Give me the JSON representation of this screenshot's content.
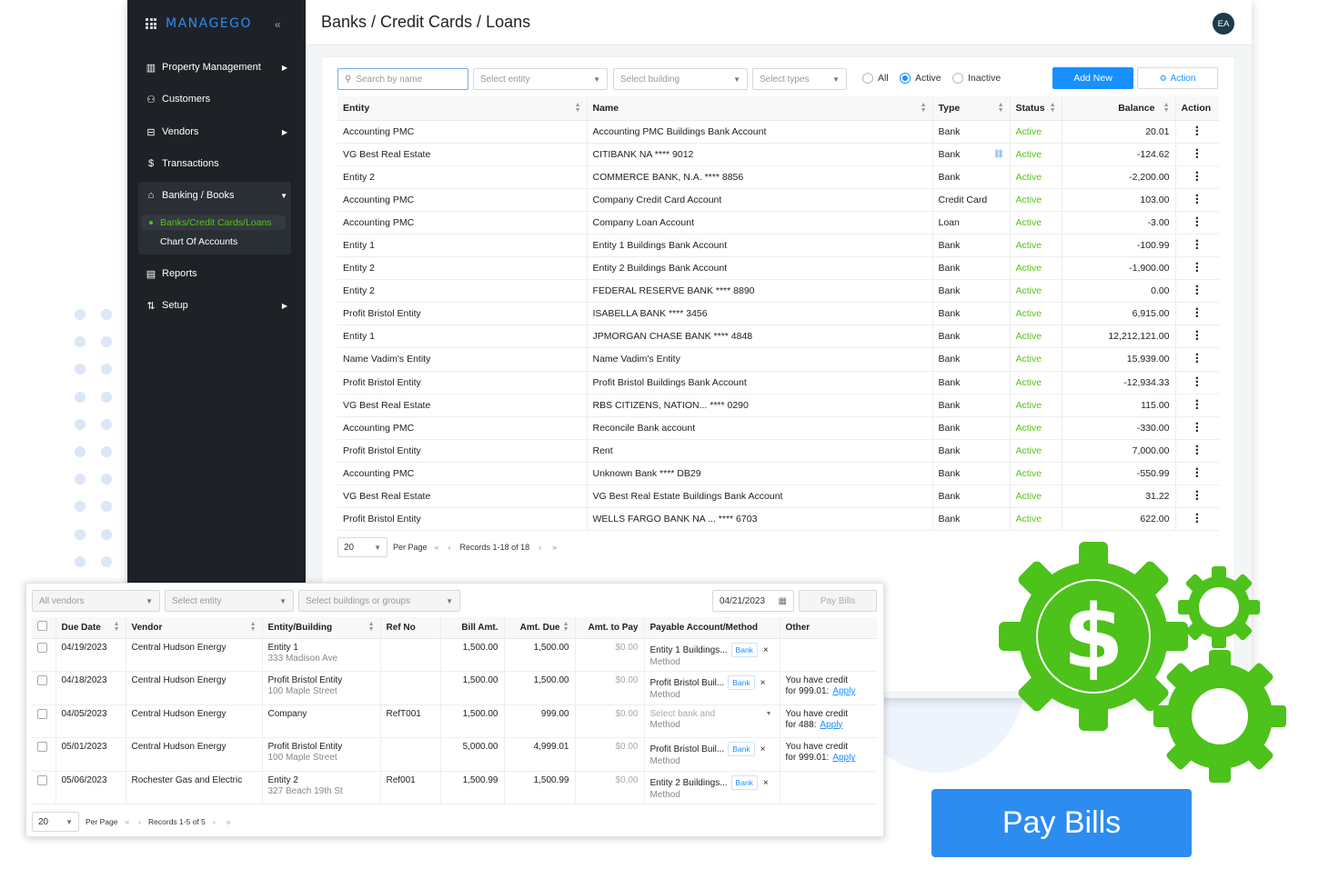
{
  "brand": {
    "logo": "MANAGEGO",
    "collapse": "«"
  },
  "sidebar": {
    "items": [
      {
        "label": "Property Management",
        "icon": "building-icon"
      },
      {
        "label": "Customers",
        "icon": "users-icon"
      },
      {
        "label": "Vendors",
        "icon": "store-icon"
      },
      {
        "label": "Transactions",
        "icon": "dollar-icon"
      },
      {
        "label": "Banking / Books",
        "icon": "bank-icon"
      },
      {
        "label": "Reports",
        "icon": "report-icon"
      },
      {
        "label": "Setup",
        "icon": "sort-icon"
      }
    ],
    "banking_sub": [
      "Banks/Credit Cards/Loans",
      "Chart Of Accounts"
    ]
  },
  "header": {
    "title": "Banks / Credit Cards / Loans",
    "avatar": "EA"
  },
  "filters": {
    "search_placeholder": "Search by name",
    "entity": "Select entity",
    "building": "Select building",
    "types": "Select types",
    "radio_all": "All",
    "radio_active": "Active",
    "radio_inactive": "Inactive",
    "add_new": "Add New",
    "action": "Action"
  },
  "accounts_table": {
    "columns": [
      "Entity",
      "Name",
      "Type",
      "Status",
      "Balance",
      "Action"
    ],
    "rows": [
      [
        "Accounting PMC",
        "Accounting PMC Buildings Bank Account",
        "Bank",
        "Active",
        "20.01"
      ],
      [
        "VG Best Real Estate",
        "CITIBANK NA **** 9012",
        "Bank",
        "Active",
        "-124.62"
      ],
      [
        "Entity 2",
        "COMMERCE BANK, N.A. **** 8856",
        "Bank",
        "Active",
        "-2,200.00"
      ],
      [
        "Accounting PMC",
        "Company Credit Card Account",
        "Credit Card",
        "Active",
        "103.00"
      ],
      [
        "Accounting PMC",
        "Company Loan Account",
        "Loan",
        "Active",
        "-3.00"
      ],
      [
        "Entity 1",
        "Entity 1 Buildings Bank Account",
        "Bank",
        "Active",
        "-100.99"
      ],
      [
        "Entity 2",
        "Entity 2 Buildings Bank Account",
        "Bank",
        "Active",
        "-1,900.00"
      ],
      [
        "Entity 2",
        "FEDERAL RESERVE BANK **** 8890",
        "Bank",
        "Active",
        "0.00"
      ],
      [
        "Profit Bristol Entity",
        "ISABELLA BANK **** 3456",
        "Bank",
        "Active",
        "6,915.00"
      ],
      [
        "Entity 1",
        "JPMORGAN CHASE BANK **** 4848",
        "Bank",
        "Active",
        "12,212,121.00"
      ],
      [
        "Name Vadim's Entity",
        "Name Vadim's Entity",
        "Bank",
        "Active",
        "15,939.00"
      ],
      [
        "Profit Bristol Entity",
        "Profit Bristol Buildings Bank Account",
        "Bank",
        "Active",
        "-12,934.33"
      ],
      [
        "VG Best Real Estate",
        "RBS CITIZENS, NATION... **** 0290",
        "Bank",
        "Active",
        "115.00"
      ],
      [
        "Accounting PMC",
        "Reconcile Bank account",
        "Bank",
        "Active",
        "-330.00"
      ],
      [
        "Profit Bristol Entity",
        "Rent",
        "Bank",
        "Active",
        "7,000.00"
      ],
      [
        "Accounting PMC",
        "Unknown Bank **** DB29",
        "Bank",
        "Active",
        "-550.99"
      ],
      [
        "VG Best Real Estate",
        "VG Best Real Estate Buildings Bank Account",
        "Bank",
        "Active",
        "31.22"
      ],
      [
        "Profit Bristol Entity",
        "WELLS FARGO BANK NA ... **** 6703",
        "Bank",
        "Active",
        "622.00"
      ]
    ],
    "pager": {
      "size": "20",
      "per_page": "Per Page",
      "records": "Records 1-18 of 18"
    }
  },
  "bills": {
    "filters": {
      "vendors": "All vendors",
      "entity": "Select entity",
      "buildings": "Select buildings or groups",
      "date": "04/21/2023",
      "pay_button": "Pay Bills"
    },
    "columns": [
      "Due Date",
      "Vendor",
      "Entity/Building",
      "Ref No",
      "Bill Amt.",
      "Amt. Due",
      "Amt. to Pay",
      "Payable Account/Method",
      "Other"
    ],
    "rows": [
      {
        "due": "04/19/2023",
        "vendor": "Central Hudson Energy",
        "entity": "Entity 1",
        "address": "333 Madison Ave",
        "ref": "",
        "bill": "1,500.00",
        "due_amt": "1,500.00",
        "pay": "$0.00",
        "account": "Entity 1 Buildings...",
        "method": "Method",
        "tag": "Bank",
        "other": "",
        "other2": ""
      },
      {
        "due": "04/18/2023",
        "vendor": "Central Hudson Energy",
        "entity": "Profit Bristol Entity",
        "address": "100 Maple Street",
        "ref": "",
        "bill": "1,500.00",
        "due_amt": "1,500.00",
        "pay": "$0.00",
        "account": "Profit Bristol Buil...",
        "method": "Method",
        "tag": "Bank",
        "other": "You have credit",
        "other2": "for 999.01:"
      },
      {
        "due": "04/05/2023",
        "vendor": "Central Hudson Energy",
        "entity": "Company",
        "address": "",
        "ref": "RefT001",
        "bill": "1,500.00",
        "due_amt": "999.00",
        "pay": "$0.00",
        "account": "Select bank and",
        "method": "Method",
        "tag": "",
        "other": "You have credit",
        "other2": "for 488:"
      },
      {
        "due": "05/01/2023",
        "vendor": "Central Hudson Energy",
        "entity": "Profit Bristol Entity",
        "address": "100 Maple Street",
        "ref": "",
        "bill": "5,000.00",
        "due_amt": "4,999.01",
        "pay": "$0.00",
        "account": "Profit Bristol Buil...",
        "method": "Method",
        "tag": "Bank",
        "other": "You have credit",
        "other2": "for 999.01:"
      },
      {
        "due": "05/06/2023",
        "vendor": "Rochester Gas and Electric",
        "entity": "Entity 2",
        "address": "327 Beach 19th St",
        "ref": "Ref001",
        "bill": "1,500.99",
        "due_amt": "1,500.99",
        "pay": "$0.00",
        "account": "Entity 2 Buildings...",
        "method": "Method",
        "tag": "Bank",
        "other": "",
        "other2": ""
      }
    ],
    "apply": "Apply",
    "pager": {
      "size": "20",
      "per_page": "Per Page",
      "records": "Records 1-5 of 5"
    }
  },
  "cta": {
    "label": "Pay Bills"
  },
  "colors": {
    "accent": "#2d8cf0",
    "active": "#52c41a",
    "gear": "#4cc21a",
    "sidebar": "#1e2227"
  }
}
